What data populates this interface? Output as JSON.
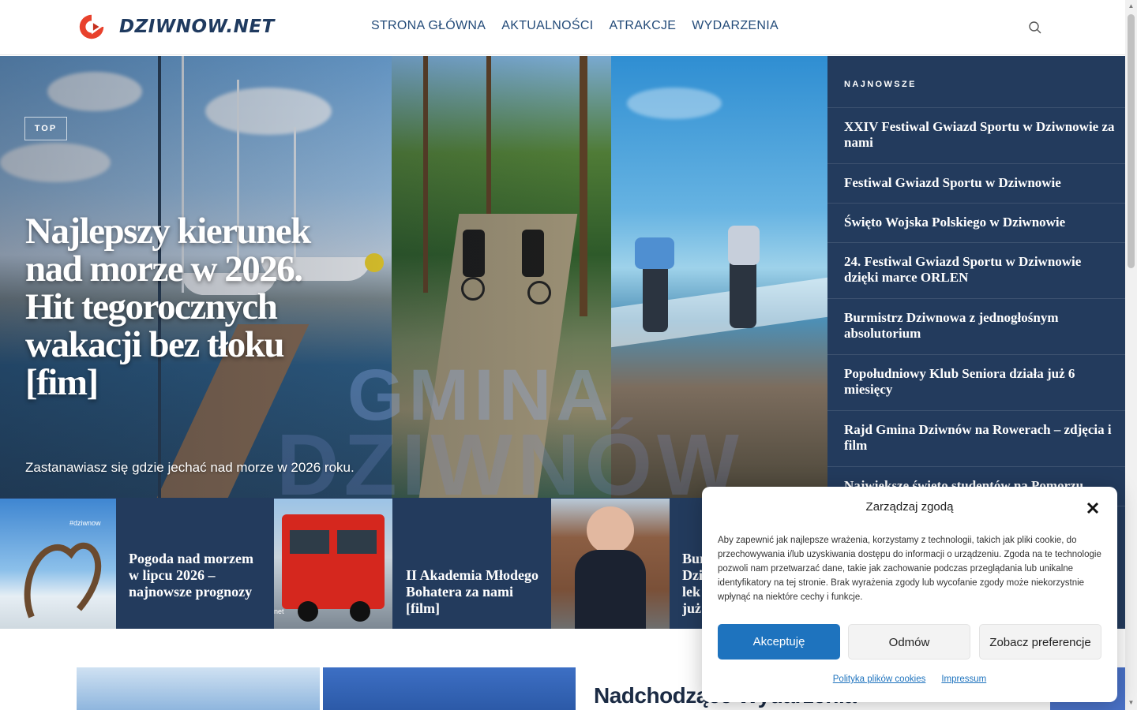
{
  "site": {
    "logo_text": "DZIWNOW.NET",
    "brand_color": "#233b5d",
    "accent_color": "#e8412c"
  },
  "nav": {
    "items": [
      {
        "label": "STRONA GŁÓWNA"
      },
      {
        "label": "AKTUALNOŚCI"
      },
      {
        "label": "ATRAKCJE"
      },
      {
        "label": "WYDARZENIA"
      }
    ],
    "search_icon": "search-icon"
  },
  "hero": {
    "badge": "TOP",
    "title": "Najlepszy kierunek nad morze w 2026. Hit tegorocznych wakacji bez tłoku [fim]",
    "excerpt": "Zastanawiasz się gdzie jechać nad morze w 2026 roku.",
    "watermark_line1": "GMINA",
    "watermark_line2": "DZIWNÓW"
  },
  "latest": {
    "heading": "NAJNOWSZE",
    "items": [
      {
        "title": "XXIV Festiwal Gwiazd Sportu w Dziwnowie za nami"
      },
      {
        "title": "Festiwal Gwiazd Sportu w Dziwnowie"
      },
      {
        "title": "Święto Wojska Polskiego w Dziwnowie"
      },
      {
        "title": "24. Festiwal Gwiazd Sportu w Dziwnowie dzięki marce ORLEN"
      },
      {
        "title": "Burmistrz Dziwnowa z jednogłośnym absolutorium"
      },
      {
        "title": "Popołudniowy Klub Seniora działa już 6 miesięcy"
      },
      {
        "title": "Rajd Gmina Dziwnów na Rowerach – zdjęcia i film"
      },
      {
        "title": "Największe święto studentów na Pomorzu"
      }
    ]
  },
  "strip": {
    "cards": [
      {
        "title": "Pogoda nad morzem w lipcu 2026 – najnowsze prognozy",
        "image_caption": "#dziwnow"
      },
      {
        "title": "II Akademia Młodego Bohatera za nami [film]",
        "image_caption": "net"
      },
      {
        "title": "Bur Dzi lek już",
        "image_caption": ""
      }
    ]
  },
  "lower": {
    "section_title": "Nadchodzące Wydarzenia"
  },
  "consent": {
    "title": "Zarządzaj zgodą",
    "text": "Aby zapewnić jak najlepsze wrażenia, korzystamy z technologii, takich jak pliki cookie, do przechowywania i/lub uzyskiwania dostępu do informacji o urządzeniu. Zgoda na te technologie pozwoli nam przetwarzać dane, takie jak zachowanie podczas przeglądania lub unikalne identyfikatory na tej stronie. Brak wyrażenia zgody lub wycofanie zgody może niekorzystnie wpłynąć na niektóre cechy i funkcje.",
    "accept_label": "Akceptuję",
    "deny_label": "Odmów",
    "prefs_label": "Zobacz preferencje",
    "cookie_policy_link": "Polityka plików cookies",
    "impressum_link": "Impressum",
    "accept_color": "#1e73be"
  }
}
